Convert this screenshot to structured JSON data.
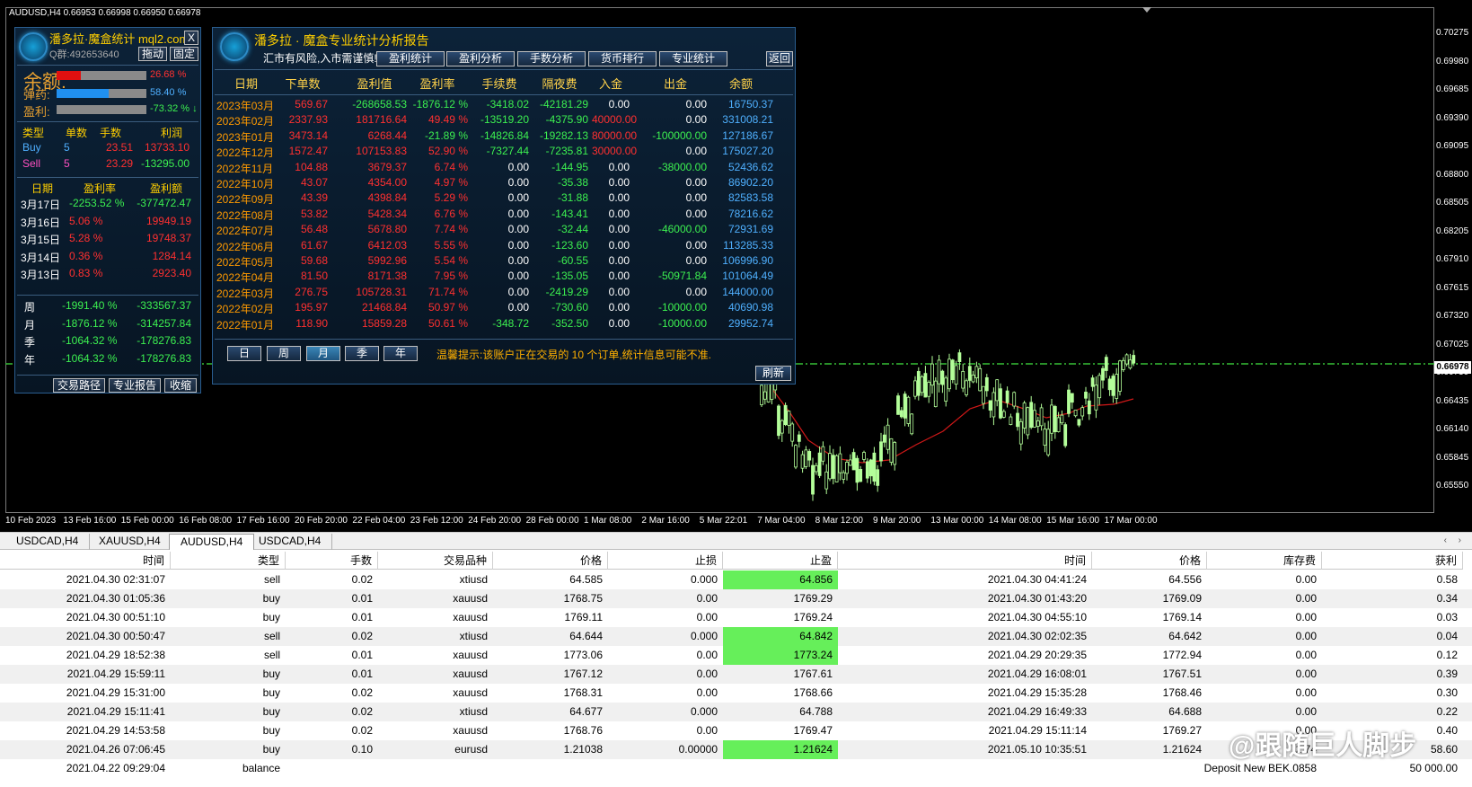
{
  "chart": {
    "symbol_line": "AUDUSD,H4  0.66953 0.66998 0.66950 0.66978",
    "price_labels": [
      "0.70275",
      "0.69980",
      "0.69685",
      "0.69390",
      "0.69095",
      "0.68800",
      "0.68505",
      "0.68205",
      "0.67910",
      "0.67615",
      "0.67320",
      "0.67025",
      "0.66730",
      "0.66435",
      "0.66140",
      "0.65845",
      "0.65550"
    ],
    "current_price": "0.66978",
    "time_labels": [
      "10 Feb 2023",
      "13 Feb 16:00",
      "15 Feb 00:00",
      "16 Feb 08:00",
      "17 Feb 16:00",
      "20 Feb 20:00",
      "22 Feb 04:00",
      "23 Feb 12:00",
      "24 Feb 20:00",
      "28 Feb 00:00",
      "1 Mar 08:00",
      "2 Mar 16:00",
      "5 Mar 22:01",
      "7 Mar 04:00",
      "8 Mar 12:00",
      "9 Mar 20:00",
      "13 Mar 00:00",
      "14 Mar 08:00",
      "15 Mar 16:00",
      "17 Mar 00:00"
    ],
    "candle_color": "#b4ff9a",
    "ma_color": "#d01818",
    "level_color": "#37c037"
  },
  "left_panel": {
    "title": "潘多拉·魔盒统计 mql2.com",
    "qq": "Q群:492653640",
    "close_label": "X",
    "drag_label": "拖动",
    "fix_label": "固定",
    "balance_label": "余额:",
    "ammo_label": "弹药:",
    "profit_label": "盈利:",
    "balance_pct": "26.68 %",
    "ammo_pct": "58.40 %",
    "profit_pct": "-73.32 % ↓",
    "bars": {
      "balance": 0.27,
      "ammo": 0.58
    },
    "pos_headers": [
      "类型",
      "单数",
      "手数",
      "利润"
    ],
    "positions": [
      {
        "type": "Buy",
        "count": "5",
        "lots": "23.51",
        "profit": "13733.10"
      },
      {
        "type": "Sell",
        "count": "5",
        "lots": "23.29",
        "profit": "-13295.00"
      }
    ],
    "day_headers": [
      "日期",
      "盈利率",
      "盈利额"
    ],
    "days": [
      {
        "date": "3月17日",
        "rate": "-2253.52 %",
        "amount": "-377472.47"
      },
      {
        "date": "3月16日",
        "rate": "5.06 %",
        "amount": "19949.19"
      },
      {
        "date": "3月15日",
        "rate": "5.28 %",
        "amount": "19748.37"
      },
      {
        "date": "3月14日",
        "rate": "0.36 %",
        "amount": "1284.14"
      },
      {
        "date": "3月13日",
        "rate": "0.83 %",
        "amount": "2923.40"
      }
    ],
    "periods": [
      {
        "label": "周",
        "rate": "-1991.40 %",
        "amount": "-333567.37"
      },
      {
        "label": "月",
        "rate": "-1876.12 %",
        "amount": "-314257.84"
      },
      {
        "label": "季",
        "rate": "-1064.32 %",
        "amount": "-178276.83"
      },
      {
        "label": "年",
        "rate": "-1064.32 %",
        "amount": "-178276.83"
      }
    ],
    "buttons": [
      "交易路径",
      "专业报告",
      "收缩"
    ]
  },
  "report": {
    "title": "潘多拉 · 魔盒专业统计分析报告",
    "subtitle": "汇市有风险,入市需谨慎!",
    "tabs": [
      "盈利统计",
      "盈利分析",
      "手数分析",
      "货币排行",
      "专业统计"
    ],
    "back_label": "返回",
    "headers": [
      "日期",
      "下单数",
      "盈利值",
      "盈利率",
      "手续费",
      "隔夜费",
      "入金",
      "出金",
      "余额"
    ],
    "rows": [
      [
        "2023年03月",
        "569.67",
        "-268658.53",
        "-1876.12 %",
        "-3418.02",
        "-42181.29",
        "0.00",
        "0.00",
        "16750.37"
      ],
      [
        "2023年02月",
        "2337.93",
        "181716.64",
        "49.49 %",
        "-13519.20",
        "-4375.90",
        "40000.00",
        "0.00",
        "331008.21"
      ],
      [
        "2023年01月",
        "3473.14",
        "6268.44",
        "-21.89 %",
        "-14826.84",
        "-19282.13",
        "80000.00",
        "-100000.00",
        "127186.67"
      ],
      [
        "2022年12月",
        "1572.47",
        "107153.83",
        "52.90 %",
        "-7327.44",
        "-7235.81",
        "30000.00",
        "0.00",
        "175027.20"
      ],
      [
        "2022年11月",
        "104.88",
        "3679.37",
        "6.74 %",
        "0.00",
        "-144.95",
        "0.00",
        "-38000.00",
        "52436.62"
      ],
      [
        "2022年10月",
        "43.07",
        "4354.00",
        "4.97 %",
        "0.00",
        "-35.38",
        "0.00",
        "0.00",
        "86902.20"
      ],
      [
        "2022年09月",
        "43.39",
        "4398.84",
        "5.29 %",
        "0.00",
        "-31.88",
        "0.00",
        "0.00",
        "82583.58"
      ],
      [
        "2022年08月",
        "53.82",
        "5428.34",
        "6.76 %",
        "0.00",
        "-143.41",
        "0.00",
        "0.00",
        "78216.62"
      ],
      [
        "2022年07月",
        "56.48",
        "5678.80",
        "7.74 %",
        "0.00",
        "-32.44",
        "0.00",
        "-46000.00",
        "72931.69"
      ],
      [
        "2022年06月",
        "61.67",
        "6412.03",
        "5.55 %",
        "0.00",
        "-123.60",
        "0.00",
        "0.00",
        "113285.33"
      ],
      [
        "2022年05月",
        "59.68",
        "5992.96",
        "5.54 %",
        "0.00",
        "-60.55",
        "0.00",
        "0.00",
        "106996.90"
      ],
      [
        "2022年04月",
        "81.50",
        "8171.38",
        "7.95 %",
        "0.00",
        "-135.05",
        "0.00",
        "-50971.84",
        "101064.49"
      ],
      [
        "2022年03月",
        "276.75",
        "105728.31",
        "71.74 %",
        "0.00",
        "-2419.29",
        "0.00",
        "0.00",
        "144000.00"
      ],
      [
        "2022年02月",
        "195.97",
        "21468.84",
        "50.97 %",
        "0.00",
        "-730.60",
        "0.00",
        "-10000.00",
        "40690.98"
      ],
      [
        "2022年01月",
        "118.90",
        "15859.28",
        "50.61 %",
        "-348.72",
        "-352.50",
        "0.00",
        "-10000.00",
        "29952.74"
      ]
    ],
    "period_buttons": [
      "日",
      "周",
      "月",
      "季",
      "年"
    ],
    "notice": "温馨提示:该账户正在交易的 10 个订单,统计信息可能不准.",
    "refresh_label": "刷新"
  },
  "chart_tabs": [
    "USDCAD,H4",
    "XAUUSD,H4",
    "AUDUSD,H4",
    "USDCAD,H4"
  ],
  "active_tab": 2,
  "table": {
    "headers": [
      "时间",
      "类型",
      "手数",
      "交易品种",
      "价格",
      "止损",
      "止盈",
      "时间",
      "价格",
      "库存费",
      "获利"
    ],
    "rows": [
      [
        "2021.04.30 02:31:07",
        "sell",
        "0.02",
        "xtiusd",
        "64.585",
        "0.000",
        "64.856",
        "2021.04.30 04:41:24",
        "64.556",
        "0.00",
        "0.58"
      ],
      [
        "2021.04.30 01:05:36",
        "buy",
        "0.01",
        "xauusd",
        "1768.75",
        "0.00",
        "1769.29",
        "2021.04.30 01:43:20",
        "1769.09",
        "0.00",
        "0.34"
      ],
      [
        "2021.04.30 00:51:10",
        "buy",
        "0.01",
        "xauusd",
        "1769.11",
        "0.00",
        "1769.24",
        "2021.04.30 04:55:10",
        "1769.14",
        "0.00",
        "0.03"
      ],
      [
        "2021.04.30 00:50:47",
        "sell",
        "0.02",
        "xtiusd",
        "64.644",
        "0.000",
        "64.842",
        "2021.04.30 02:02:35",
        "64.642",
        "0.00",
        "0.04"
      ],
      [
        "2021.04.29 18:52:38",
        "sell",
        "0.01",
        "xauusd",
        "1773.06",
        "0.00",
        "1773.24",
        "2021.04.29 20:29:35",
        "1772.94",
        "0.00",
        "0.12"
      ],
      [
        "2021.04.29 15:59:11",
        "buy",
        "0.01",
        "xauusd",
        "1767.12",
        "0.00",
        "1767.61",
        "2021.04.29 16:08:01",
        "1767.51",
        "0.00",
        "0.39"
      ],
      [
        "2021.04.29 15:31:00",
        "buy",
        "0.02",
        "xauusd",
        "1768.31",
        "0.00",
        "1768.66",
        "2021.04.29 15:35:28",
        "1768.46",
        "0.00",
        "0.30"
      ],
      [
        "2021.04.29 15:11:41",
        "buy",
        "0.02",
        "xtiusd",
        "64.677",
        "0.000",
        "64.788",
        "2021.04.29 16:49:33",
        "64.688",
        "0.00",
        "0.22"
      ],
      [
        "2021.04.29 14:53:58",
        "buy",
        "0.02",
        "xauusd",
        "1768.76",
        "0.00",
        "1769.47",
        "2021.04.29 15:11:14",
        "1769.27",
        "0.00",
        "0.40"
      ],
      [
        "2021.04.26 07:06:45",
        "buy",
        "0.10",
        "eurusd",
        "1.21038",
        "0.00000",
        "1.21624",
        "2021.05.10 10:35:51",
        "1.21624",
        "-2.74",
        "58.60"
      ]
    ],
    "highlight_rows": [
      0,
      3,
      4,
      9
    ],
    "balance_row": {
      "time": "2021.04.22 09:29:04",
      "type": "balance",
      "comment": "Deposit New BEK.0858",
      "amount": "50 000.00"
    }
  },
  "watermark": "@跟随巨人脚步"
}
